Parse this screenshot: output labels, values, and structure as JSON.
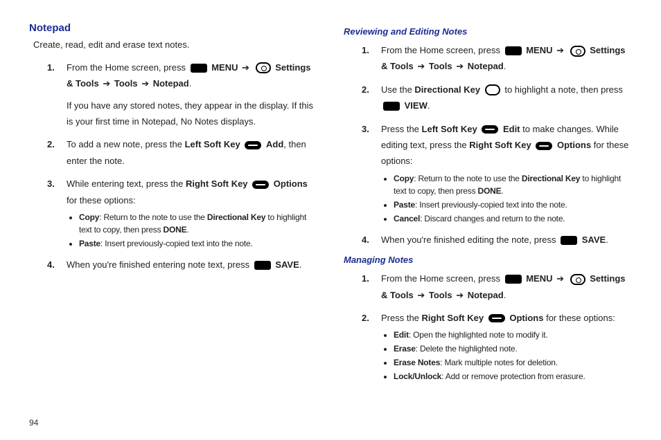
{
  "page_number": "94",
  "left": {
    "heading": "Notepad",
    "intro": "Create, read, edit and erase text notes.",
    "s1a": "From the Home screen, press ",
    "s1_menu": "MENU",
    "s1b": " ",
    "s1_path1": "Settings & Tools",
    "s1_path2": "Tools",
    "s1_path3": "Notepad",
    "s1_note": "If you have any stored notes, they appear in the display. If this is your first time in Notepad, No Notes displays.",
    "s2a": "To add a new note, press the ",
    "s2_lsk": "Left Soft Key",
    "s2_add": "Add",
    "s2b": ", then enter the note.",
    "s3a": "While entering text, press the ",
    "s3_rsk": "Right Soft Key",
    "s3_opt": "Options",
    "s3b": " for these options:",
    "s3_copy_lbl": "Copy",
    "s3_copy_txt": ": Return to the note to use the ",
    "s3_copy_dk": "Directional Key",
    "s3_copy_txt2": " to highlight text to copy, then press ",
    "s3_copy_done": "DONE",
    "s3_paste_lbl": "Paste",
    "s3_paste_txt": ": Insert previously-copied text into the note.",
    "s4a": "When you're finished entering note text, press ",
    "s4_save": "SAVE"
  },
  "right": {
    "h_review": "Reviewing and Editing Notes",
    "s1a": "From the Home screen, press ",
    "s1_menu": "MENU",
    "s1_path1": "Settings & Tools",
    "s1_path2": "Tools",
    "s1_path3": "Notepad",
    "s2a": "Use the ",
    "s2_dk": "Directional Key",
    "s2b": " to highlight a note, then press ",
    "s2_view": "VIEW",
    "s3a": "Press the ",
    "s3_lsk": "Left Soft Key",
    "s3_edit": "Edit",
    "s3b": " to make changes. While editing text, press the ",
    "s3_rsk": "Right Soft Key",
    "s3_opt": "Options",
    "s3c": " for these options:",
    "s3_copy_lbl": "Copy",
    "s3_copy_txt": ": Return to the note to use the ",
    "s3_copy_dk": "Directional Key",
    "s3_copy_txt2": " to highlight text to copy, then press ",
    "s3_copy_done": "DONE",
    "s3_paste_lbl": "Paste",
    "s3_paste_txt": ": Insert previously-copied text into the note.",
    "s3_cancel_lbl": "Cancel",
    "s3_cancel_txt": ": Discard changes and return to the note.",
    "s4a": "When you're finished editing the note, press ",
    "s4_save": "SAVE",
    "h_manage": "Managing Notes",
    "m1a": "From the Home screen, press ",
    "m1_menu": "MENU",
    "m1_path1": "Settings & Tools",
    "m1_path2": "Tools",
    "m1_path3": "Notepad",
    "m2a": "Press the ",
    "m2_rsk": "Right Soft Key",
    "m2_opt": "Options",
    "m2b": " for these options:",
    "m2_edit_lbl": "Edit",
    "m2_edit_txt": ": Open the highlighted note to modify it.",
    "m2_erase_lbl": "Erase",
    "m2_erase_txt": ": Delete the highlighted note.",
    "m2_erasen_lbl": "Erase Notes",
    "m2_erasen_txt": ": Mark multiple notes for deletion.",
    "m2_lock_lbl": "Lock/Unlock",
    "m2_lock_txt": ": Add or remove protection from erasure."
  }
}
